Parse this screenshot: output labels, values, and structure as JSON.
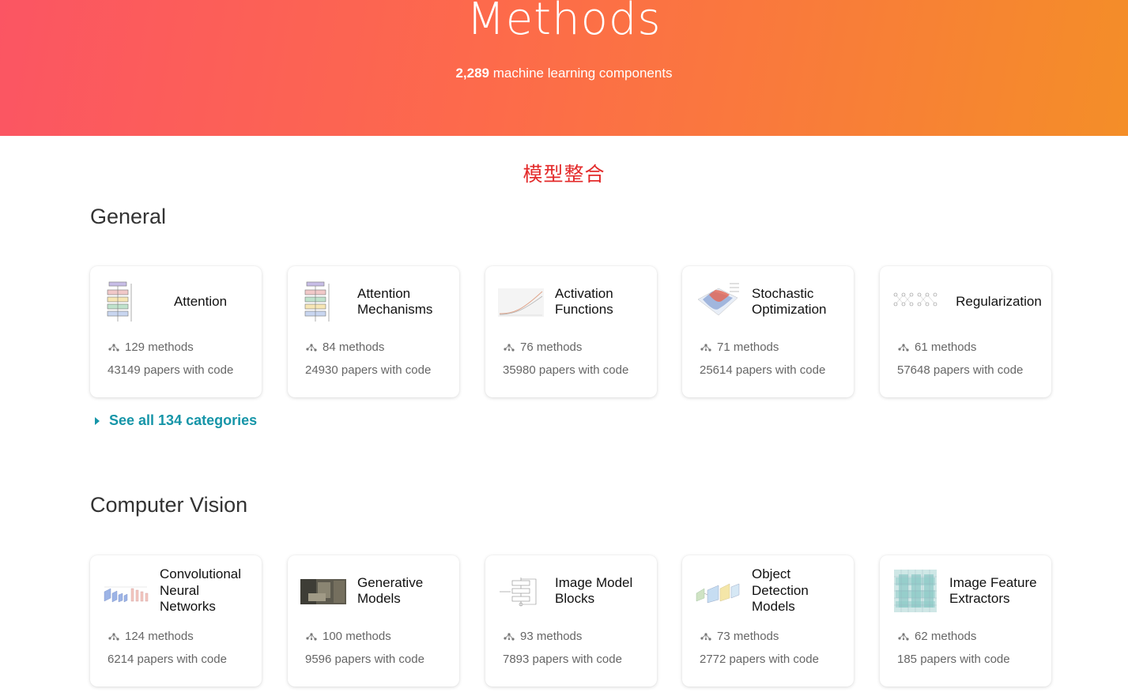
{
  "hero": {
    "title": "Methods",
    "count": "2,289",
    "subtitle_rest": "machine learning components",
    "gradient_start": "#fb5563",
    "gradient_end": "#f48e28"
  },
  "banner": {
    "text": "模型整合",
    "color": "#e32a2a"
  },
  "sections": [
    {
      "title": "General",
      "see_all": "See all 134 categories",
      "cards": [
        {
          "title": "Attention",
          "thumb": "transformer-diagram",
          "methods": "129 methods",
          "papers": "43149 papers with code"
        },
        {
          "title": "Attention Mechanisms",
          "thumb": "transformer-diagram",
          "methods": "84 methods",
          "papers": "24930 papers with code"
        },
        {
          "title": "Activation Functions",
          "thumb": "activation-curve",
          "methods": "76 methods",
          "papers": "35980 papers with code"
        },
        {
          "title": "Stochastic Optimization",
          "thumb": "loss-surface",
          "methods": "71 methods",
          "papers": "25614 papers with code"
        },
        {
          "title": "Regularization",
          "thumb": "dropout-network",
          "methods": "61 methods",
          "papers": "57648 papers with code"
        }
      ]
    },
    {
      "title": "Computer Vision",
      "cards": [
        {
          "title": "Convolutional Neural Networks",
          "thumb": "cnn-diagram",
          "methods": "124 methods",
          "papers": "6214 papers with code"
        },
        {
          "title": "Generative Models",
          "thumb": "generated-image",
          "methods": "100 methods",
          "papers": "9596 papers with code"
        },
        {
          "title": "Image Model Blocks",
          "thumb": "block-diagram",
          "methods": "93 methods",
          "papers": "7893 papers with code"
        },
        {
          "title": "Object Detection Models",
          "thumb": "detection-diagram",
          "methods": "73 methods",
          "papers": "2772 papers with code"
        },
        {
          "title": "Image Feature Extractors",
          "thumb": "feature-grid",
          "methods": "62 methods",
          "papers": "185 papers with code"
        }
      ]
    }
  ]
}
